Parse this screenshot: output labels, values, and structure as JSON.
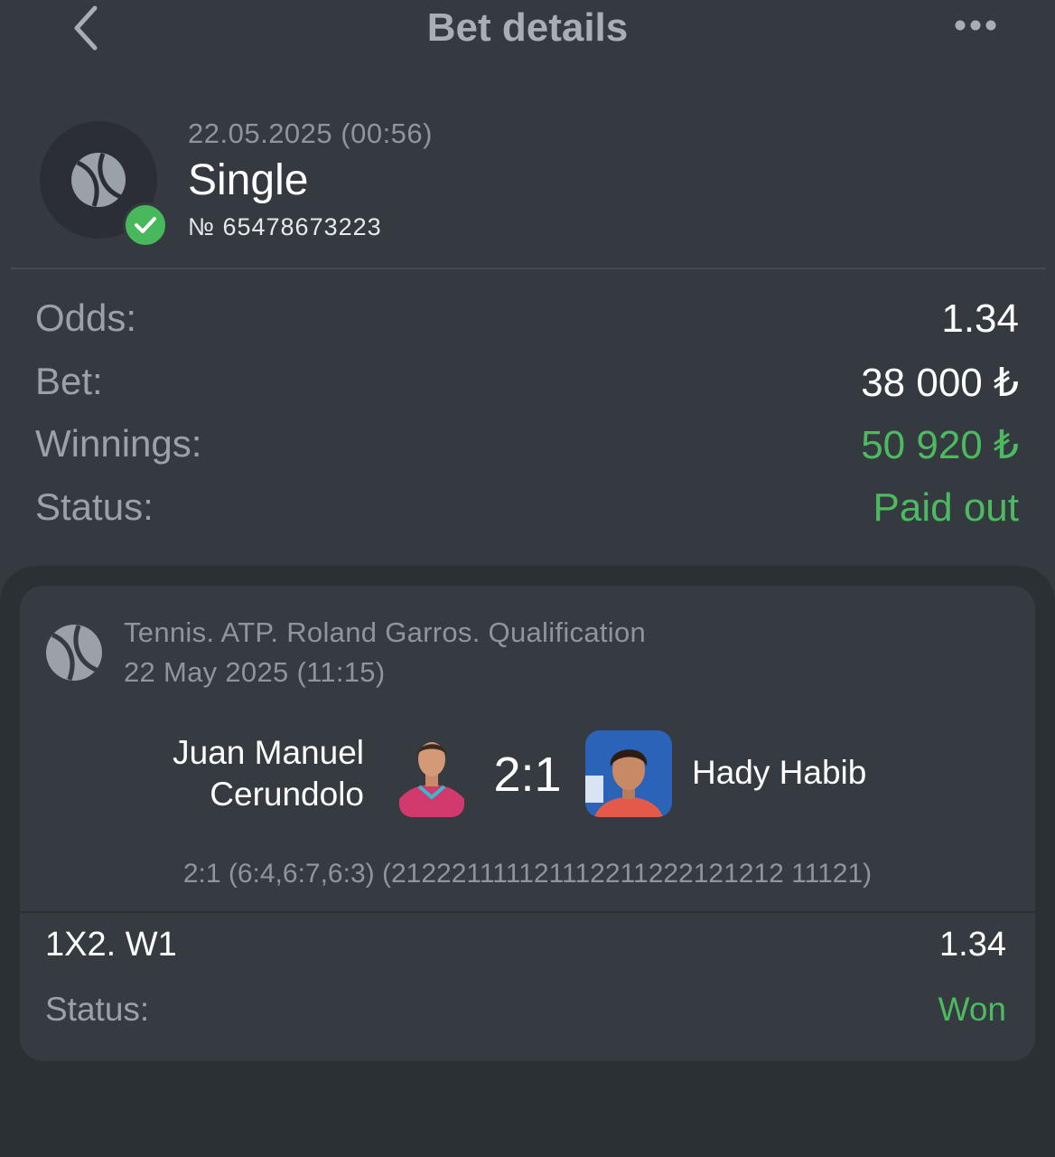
{
  "header": {
    "title": "Bet details"
  },
  "bet": {
    "date": "22.05.2025 (00:56)",
    "type": "Single",
    "number": "№ 65478673223"
  },
  "details": [
    {
      "label": "Odds:",
      "value": "1.34"
    },
    {
      "label": "Bet:",
      "value": "38 000 ₺"
    },
    {
      "label": "Winnings:",
      "value": "50 920 ₺"
    },
    {
      "label": "Status:",
      "value": "Paid out"
    }
  ],
  "event": {
    "tournament": "Tennis. ATP. Roland Garros. Qualification",
    "date": "22 May 2025 (11:15)",
    "team1": "Juan Manuel Cerundolo",
    "team2": "Hady Habib",
    "score": "2:1",
    "set_scores": "2:1 (6:4,6:7,6:3) (212221111121112211222121212 11121)",
    "market": "1X2. W1",
    "odds": "1.34",
    "status_label": "Status:",
    "status_value": "Won"
  },
  "colors": {
    "background": "#353a40",
    "card": "#363b41",
    "green": "#4cbb60",
    "muted": "#9ba1a8"
  },
  "icons": [
    "back-chevron-icon",
    "more-dots-icon",
    "tennis-ball-icon",
    "checkmark-icon"
  ]
}
